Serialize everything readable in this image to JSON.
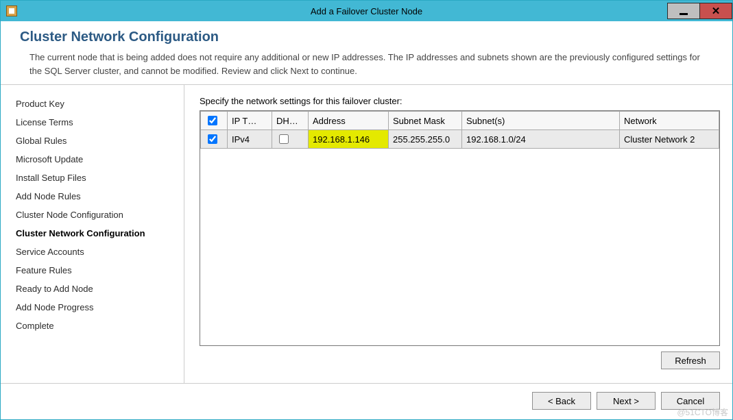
{
  "window": {
    "title": "Add a Failover Cluster Node"
  },
  "header": {
    "title": "Cluster Network Configuration",
    "description": "The current node that is being added does not require any additional or new IP addresses.  The IP addresses and subnets shown are the previously configured settings for the SQL Server cluster, and cannot be modified. Review and click Next to continue."
  },
  "sidebar": {
    "items": [
      {
        "label": "Product Key"
      },
      {
        "label": "License Terms"
      },
      {
        "label": "Global Rules"
      },
      {
        "label": "Microsoft Update"
      },
      {
        "label": "Install Setup Files"
      },
      {
        "label": "Add Node Rules"
      },
      {
        "label": "Cluster Node Configuration"
      },
      {
        "label": "Cluster Network Configuration"
      },
      {
        "label": "Service Accounts"
      },
      {
        "label": "Feature Rules"
      },
      {
        "label": "Ready to Add Node"
      },
      {
        "label": "Add Node Progress"
      },
      {
        "label": "Complete"
      }
    ],
    "active_index": 7
  },
  "main": {
    "instruction": "Specify the network settings for this failover cluster:",
    "columns": {
      "check": "",
      "iptype": "IP T…",
      "dhcp": "DH…",
      "address": "Address",
      "mask": "Subnet Mask",
      "subnets": "Subnet(s)",
      "network": "Network"
    },
    "rows": [
      {
        "checked": true,
        "iptype": "IPv4",
        "dhcp": false,
        "address": "192.168.1.146",
        "mask": "255.255.255.0",
        "subnets": "192.168.1.0/24",
        "network": "Cluster Network 2"
      }
    ],
    "refresh_label": "Refresh"
  },
  "footer": {
    "back": "< Back",
    "next": "Next >",
    "cancel": "Cancel"
  },
  "watermark": "@51CTO博客"
}
